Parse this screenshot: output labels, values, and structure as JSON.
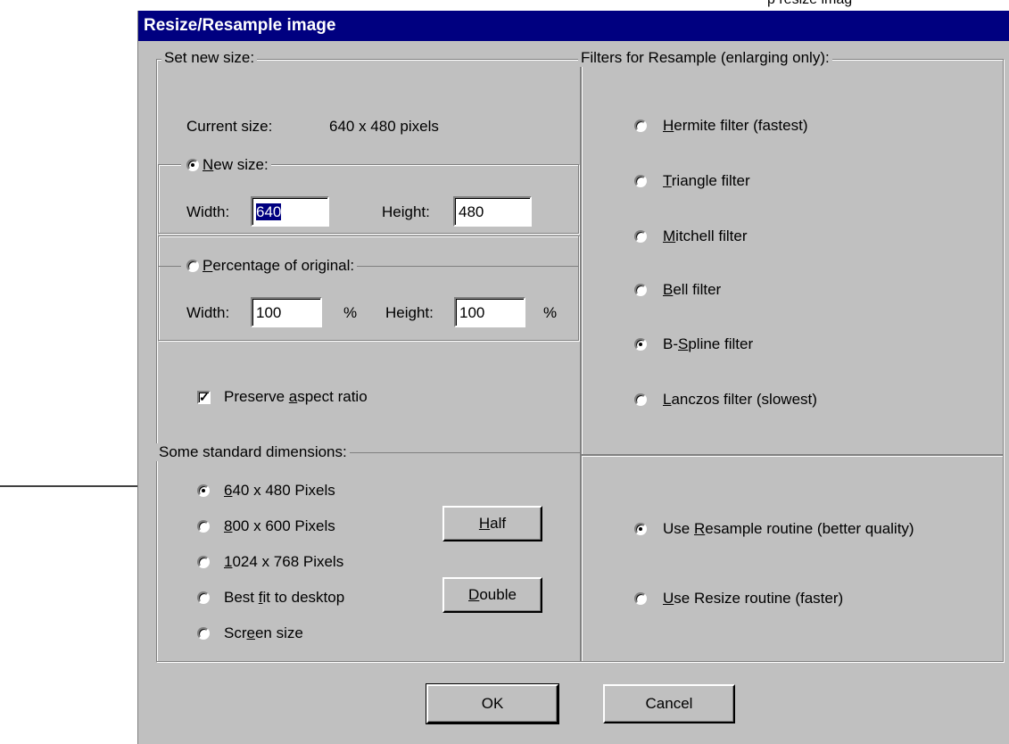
{
  "page": {
    "top_text": "p resize imag"
  },
  "dialog": {
    "title": "Resize/Resample image",
    "set_size": {
      "legend": "Set new size:",
      "current_label": "Current size:",
      "current_value": "640  x  480  pixels",
      "new_size": {
        "pre": "",
        "u": "N",
        "post": "ew size:",
        "width_label": "Width:",
        "width_value": "640",
        "height_label": "Height:",
        "height_value": "480"
      },
      "percentage": {
        "pre": "",
        "u": "P",
        "post": "ercentage of original:",
        "width_label": "Width:",
        "width_value": "100",
        "height_label": "Height:",
        "height_value": "100",
        "unit": "%"
      },
      "preserve": {
        "pre": "Preserve ",
        "u": "a",
        "post": "spect ratio",
        "checked": true,
        "mark": "✓"
      }
    },
    "standard": {
      "legend": "Some standard dimensions:",
      "options": [
        {
          "pre": "",
          "u": "6",
          "post": "40 x 480 Pixels",
          "selected": true
        },
        {
          "pre": "",
          "u": "8",
          "post": "00 x 600 Pixels",
          "selected": false
        },
        {
          "pre": "",
          "u": "1",
          "post": "024 x 768 Pixels",
          "selected": false
        },
        {
          "pre": "Best ",
          "u": "f",
          "post": "it to desktop",
          "selected": false
        },
        {
          "pre": "Scr",
          "u": "e",
          "post": "en size",
          "selected": false
        }
      ],
      "half_button": {
        "pre": "",
        "u": "H",
        "post": "alf"
      },
      "double_button": {
        "pre": "",
        "u": "D",
        "post": "ouble"
      }
    },
    "filters": {
      "legend": "Filters for Resample (enlarging only):",
      "options": [
        {
          "pre": "",
          "u": "H",
          "post": "ermite filter (fastest)",
          "selected": false
        },
        {
          "pre": "",
          "u": "T",
          "post": "riangle filter",
          "selected": false
        },
        {
          "pre": "",
          "u": "M",
          "post": "itchell filter",
          "selected": false
        },
        {
          "pre": "",
          "u": "B",
          "post": "ell filter",
          "selected": false
        },
        {
          "pre": "B-",
          "u": "S",
          "post": "pline filter",
          "selected": true
        },
        {
          "pre": "",
          "u": "L",
          "post": "anczos filter (slowest)",
          "selected": false
        }
      ]
    },
    "routine": {
      "options": [
        {
          "pre": "Use ",
          "u": "R",
          "post": "esample routine (better quality)",
          "selected": true
        },
        {
          "pre": "",
          "u": "U",
          "post": "se Resize routine (faster)",
          "selected": false
        }
      ]
    },
    "ok_label": "OK",
    "cancel_label": "Cancel"
  },
  "colors": {
    "title_bar": "#000080",
    "dialog_face": "#c0c0c0"
  }
}
